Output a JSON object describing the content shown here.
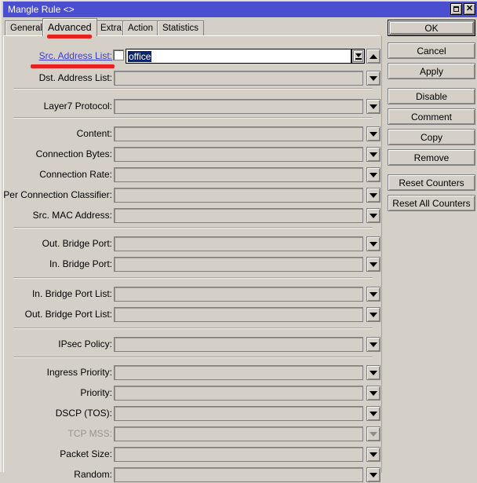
{
  "window": {
    "title": "Mangle Rule <>",
    "titlebar_color": "#4a4ecf",
    "buttons": [
      {
        "name": "maximize",
        "glyph": "maximize-icon"
      },
      {
        "name": "close",
        "glyph": "close-icon"
      }
    ]
  },
  "tabs": [
    {
      "label": "General",
      "selected": false
    },
    {
      "label": "Advanced",
      "selected": true
    },
    {
      "label": "Extra",
      "selected": false
    },
    {
      "label": "Action",
      "selected": false
    },
    {
      "label": "Statistics",
      "selected": false
    }
  ],
  "annotation": {
    "color": "#e8201f",
    "targets": [
      "Advanced",
      "Src. Address List:"
    ]
  },
  "fields": [
    {
      "label": "Src. Address List:",
      "value": "office",
      "state": "active",
      "accent": true,
      "checkbox": true,
      "control": "combo-open"
    },
    {
      "label": "Dst. Address List:",
      "value": "",
      "state": "normal",
      "control": "dropdown"
    },
    {
      "label": "Layer7 Protocol:",
      "value": "",
      "state": "normal",
      "control": "dropdown"
    },
    {
      "label": "Content:",
      "value": "",
      "state": "normal",
      "control": "dropdown"
    },
    {
      "label": "Connection Bytes:",
      "value": "",
      "state": "normal",
      "control": "dropdown"
    },
    {
      "label": "Connection Rate:",
      "value": "",
      "state": "normal",
      "control": "dropdown"
    },
    {
      "label": "Per Connection Classifier:",
      "value": "",
      "state": "normal",
      "control": "dropdown"
    },
    {
      "label": "Src. MAC Address:",
      "value": "",
      "state": "normal",
      "control": "dropdown"
    },
    {
      "label": "Out. Bridge Port:",
      "value": "",
      "state": "normal",
      "control": "dropdown"
    },
    {
      "label": "In. Bridge Port:",
      "value": "",
      "state": "normal",
      "control": "dropdown"
    },
    {
      "label": "In. Bridge Port List:",
      "value": "",
      "state": "normal",
      "control": "dropdown"
    },
    {
      "label": "Out. Bridge Port List:",
      "value": "",
      "state": "normal",
      "control": "dropdown"
    },
    {
      "label": "IPsec Policy:",
      "value": "",
      "state": "normal",
      "control": "dropdown"
    },
    {
      "label": "Ingress Priority:",
      "value": "",
      "state": "normal",
      "control": "dropdown"
    },
    {
      "label": "Priority:",
      "value": "",
      "state": "normal",
      "control": "dropdown"
    },
    {
      "label": "DSCP (TOS):",
      "value": "",
      "state": "normal",
      "control": "dropdown"
    },
    {
      "label": "TCP MSS:",
      "value": "",
      "state": "disabled",
      "control": "dropdown"
    },
    {
      "label": "Packet Size:",
      "value": "",
      "state": "normal",
      "control": "dropdown"
    },
    {
      "label": "Random:",
      "value": "",
      "state": "normal",
      "control": "dropdown"
    }
  ],
  "side_buttons": [
    {
      "label": "OK",
      "default": true
    },
    {
      "label": "Cancel",
      "default": false
    },
    {
      "label": "Apply",
      "default": false
    },
    {
      "label": "Disable",
      "default": false
    },
    {
      "label": "Comment",
      "default": false
    },
    {
      "label": "Copy",
      "default": false
    },
    {
      "label": "Remove",
      "default": false
    },
    {
      "label": "Reset Counters",
      "default": false
    },
    {
      "label": "Reset All Counters",
      "default": false
    }
  ]
}
